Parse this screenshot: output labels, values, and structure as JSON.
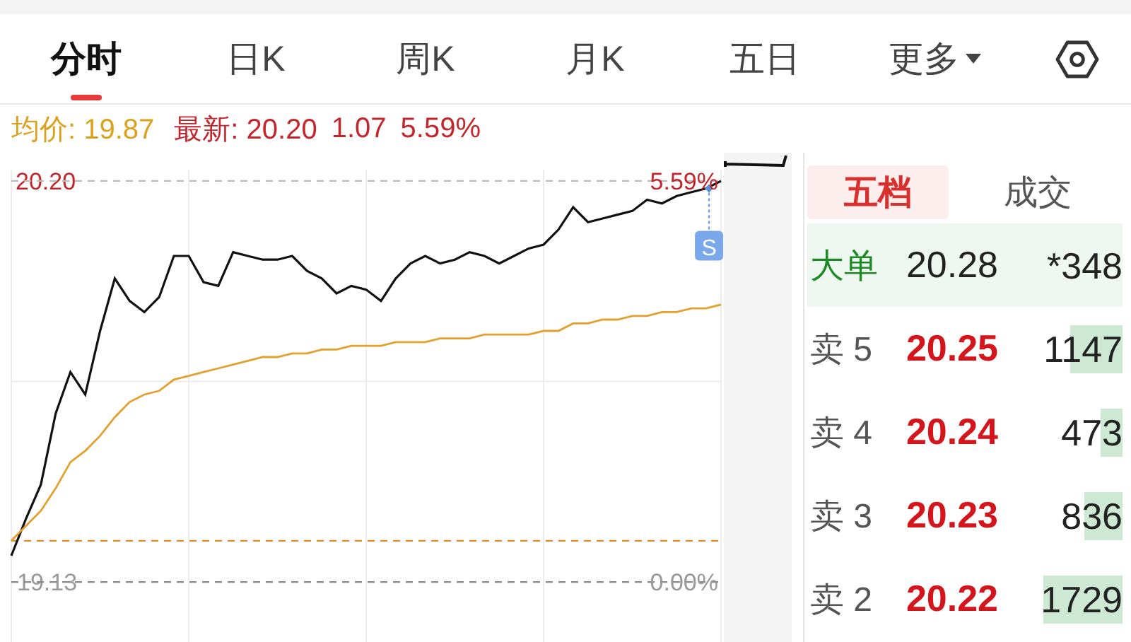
{
  "tabs": [
    {
      "label": "分时",
      "selected": true
    },
    {
      "label": "日K",
      "selected": false
    },
    {
      "label": "周K",
      "selected": false
    },
    {
      "label": "月K",
      "selected": false
    },
    {
      "label": "五日",
      "selected": false
    },
    {
      "label": "更多",
      "selected": false,
      "kind": "dropdown"
    }
  ],
  "quote": {
    "avg_label": "均价: 19.87",
    "latest_label": "最新: 20.20",
    "change": "1.07",
    "change_pct": "5.59%"
  },
  "chart": {
    "chart_data": {
      "type": "line",
      "ylim": [
        18.97,
        20.23
      ],
      "categories": [
        null,
        null,
        null,
        null,
        null,
        null,
        null,
        null,
        null,
        null,
        null,
        null,
        null,
        null,
        null,
        null,
        null,
        null,
        null,
        null,
        null,
        null,
        null,
        null,
        null,
        null,
        null,
        null,
        null,
        null,
        null,
        null,
        null,
        null,
        null,
        null,
        null,
        null,
        null,
        null,
        null,
        null,
        null,
        null,
        null,
        null,
        null,
        null,
        null
      ],
      "series": [
        {
          "color": "#111111",
          "values": [
            19.2,
            19.3,
            19.39,
            19.58,
            19.69,
            19.63,
            19.8,
            19.94,
            19.88,
            19.85,
            19.89,
            20.0,
            20.0,
            19.93,
            19.92,
            20.01,
            20.0,
            19.99,
            19.99,
            20.0,
            19.96,
            19.94,
            19.9,
            19.92,
            19.91,
            19.88,
            19.94,
            19.98,
            20.0,
            19.98,
            19.99,
            20.01,
            20.0,
            19.98,
            20.0,
            20.02,
            20.03,
            20.07,
            20.13,
            20.09,
            20.1,
            20.11,
            20.12,
            20.15,
            20.14,
            20.16,
            20.17,
            20.18,
            20.2
          ]
        },
        {
          "color": "#e3a02c",
          "values": [
            19.24,
            19.28,
            19.32,
            19.38,
            19.45,
            19.48,
            19.52,
            19.57,
            19.61,
            19.63,
            19.64,
            19.67,
            19.68,
            19.69,
            19.7,
            19.71,
            19.72,
            19.73,
            19.73,
            19.74,
            19.74,
            19.75,
            19.75,
            19.76,
            19.76,
            19.76,
            19.77,
            19.77,
            19.77,
            19.78,
            19.78,
            19.78,
            19.79,
            19.79,
            19.79,
            19.79,
            19.8,
            19.8,
            19.82,
            19.82,
            19.83,
            19.83,
            19.84,
            19.84,
            19.85,
            19.85,
            19.86,
            19.86,
            19.87
          ]
        }
      ],
      "yticks": [
        {
          "value": 20.2,
          "label": "20.20"
        },
        {
          "value": 19.13,
          "label": "19.13"
        }
      ],
      "y2ticks": [
        {
          "value": 5.59,
          "label": "5.59%"
        },
        {
          "value": 0,
          "label": "0.00%"
        }
      ],
      "y2lim": [
        -0.84,
        5.75
      ],
      "grid": true,
      "ref_lines": [
        {
          "axis": "y",
          "value": 20.2,
          "color": "#bbbbbb"
        },
        {
          "axis": "y",
          "value": 19.13,
          "color": "#888888"
        },
        {
          "axis": "y",
          "value": 19.24,
          "color": "#d9902a"
        }
      ],
      "annotations": [
        {
          "text": "S"
        }
      ]
    }
  },
  "order_book": {
    "tabs": [
      {
        "label": "五档",
        "selected": true
      },
      {
        "label": "成交",
        "selected": false
      }
    ],
    "rows": [
      {
        "kind": "big",
        "label": "大单",
        "price": "20.28",
        "volume": "*348"
      },
      {
        "kind": "ask",
        "label": "卖 5",
        "price": "20.25",
        "volume": "1147"
      },
      {
        "kind": "ask",
        "label": "卖 4",
        "price": "20.24",
        "volume": "473"
      },
      {
        "kind": "ask",
        "label": "卖 3",
        "price": "20.23",
        "volume": "836"
      },
      {
        "kind": "ask",
        "label": "卖 2",
        "price": "20.22",
        "volume": "1729"
      }
    ]
  }
}
